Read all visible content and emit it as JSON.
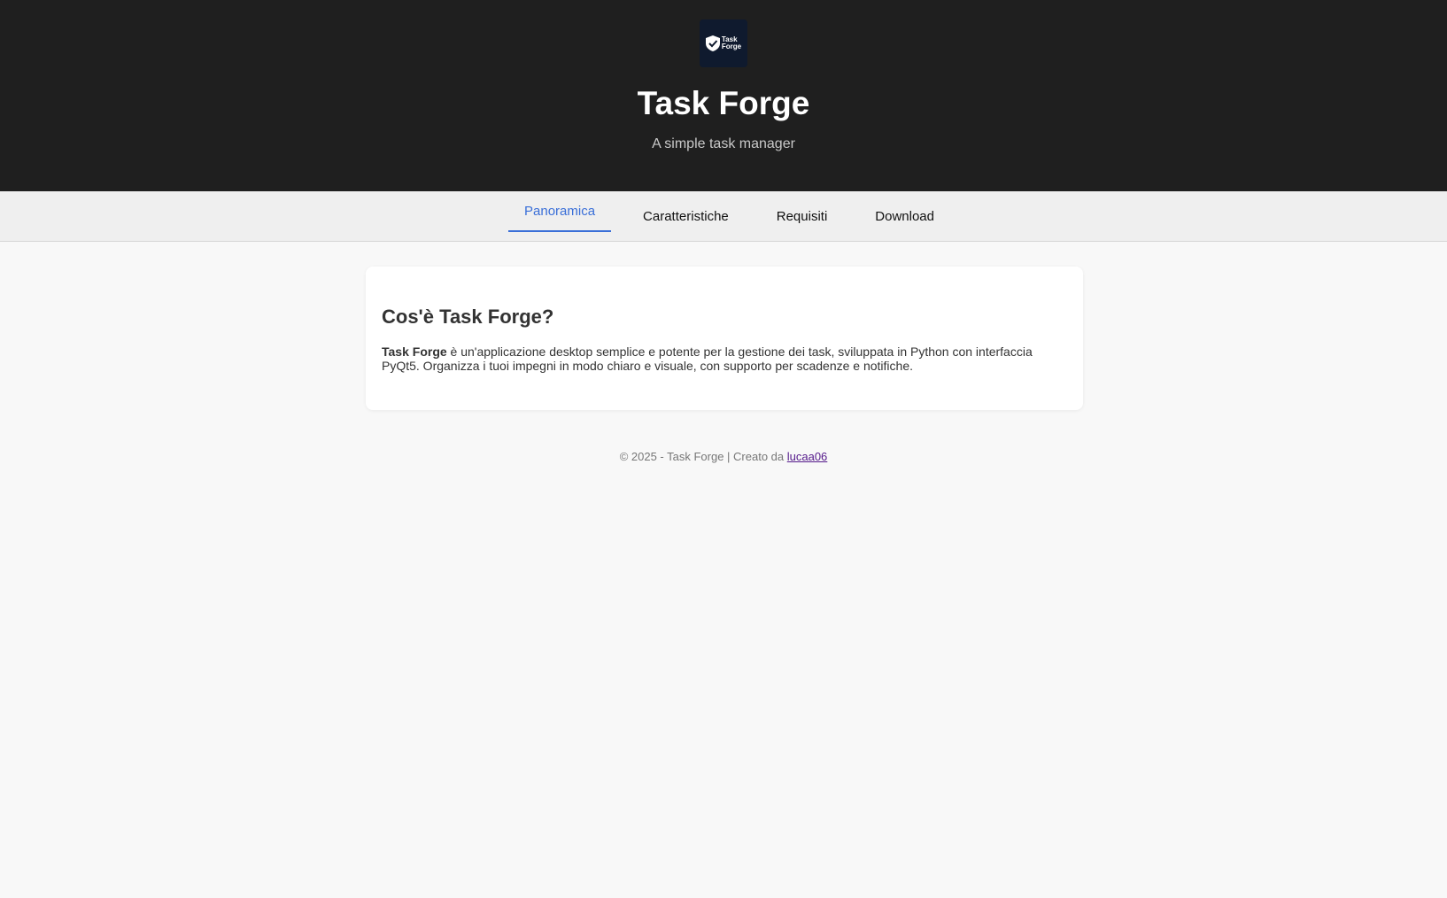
{
  "header": {
    "logo_line1": "Task",
    "logo_line2": "Forge",
    "title": "Task Forge",
    "subtitle": "A simple task manager"
  },
  "nav": {
    "tabs": [
      {
        "label": "Panoramica",
        "active": true
      },
      {
        "label": "Caratteristiche",
        "active": false
      },
      {
        "label": "Requisiti",
        "active": false
      },
      {
        "label": "Download",
        "active": false
      }
    ]
  },
  "card": {
    "heading": "Cos'è Task Forge?",
    "bold_text": "Task Forge",
    "body_text": " è un'applicazione desktop semplice e potente per la gestione dei task, sviluppata in Python con interfaccia PyQt5. Organizza i tuoi impegni in modo chiaro e visuale, con supporto per scadenze e notifiche."
  },
  "footer": {
    "text": "© 2025 - Task Forge | Creato da ",
    "link_text": "lucaa06"
  },
  "colors": {
    "header_bg": "#1f1f1f",
    "accent": "#3a6fd8",
    "page_bg": "#f8f8f8"
  }
}
